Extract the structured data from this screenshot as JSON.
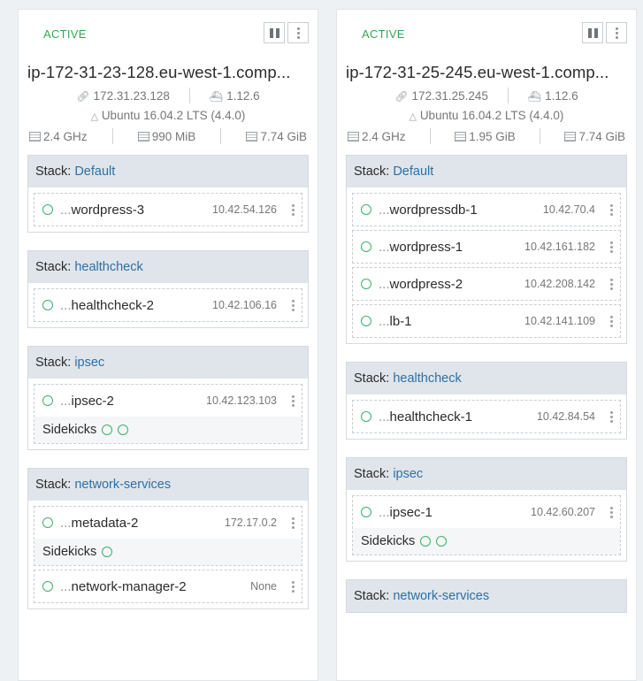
{
  "hosts": [
    {
      "state": "ACTIVE",
      "name": "ip-172-31-23-128.eu-west-1.comp...",
      "ip": "172.31.23.128",
      "docker_version": "1.12.6",
      "os": "Ubuntu 16.04.2 LTS (4.4.0)",
      "cpu": "2.4 GHz",
      "memory": "990 MiB",
      "storage": "7.74 GiB",
      "stacks": [
        {
          "label": "Stack:",
          "name": "Default",
          "containers": [
            {
              "name_prefix": "...",
              "name": "wordpress-3",
              "ip": "10.42.54.126"
            }
          ]
        },
        {
          "label": "Stack:",
          "name": "healthcheck",
          "containers": [
            {
              "name_prefix": "...",
              "name": "healthcheck-2",
              "ip": "10.42.106.16"
            }
          ]
        },
        {
          "label": "Stack:",
          "name": "ipsec",
          "containers": [
            {
              "name_prefix": "...",
              "name": "ipsec-2",
              "ip": "10.42.123.103",
              "sidekicks_label": "Sidekicks"
            }
          ]
        },
        {
          "label": "Stack:",
          "name": "network-services",
          "containers": [
            {
              "name_prefix": "...",
              "name": "metadata-2",
              "ip": "172.17.0.2",
              "sidekicks_label": "Sidekicks"
            },
            {
              "name_prefix": "...",
              "name": "network-manager-2",
              "ip": "None"
            }
          ]
        }
      ]
    },
    {
      "state": "ACTIVE",
      "name": "ip-172-31-25-245.eu-west-1.comp...",
      "ip": "172.31.25.245",
      "docker_version": "1.12.6",
      "os": "Ubuntu 16.04.2 LTS (4.4.0)",
      "cpu": "2.4 GHz",
      "memory": "1.95 GiB",
      "storage": "7.74 GiB",
      "stacks": [
        {
          "label": "Stack:",
          "name": "Default",
          "containers": [
            {
              "name_prefix": "...",
              "name": "wordpressdb-1",
              "ip": "10.42.70.4"
            },
            {
              "name_prefix": "...",
              "name": "wordpress-1",
              "ip": "10.42.161.182"
            },
            {
              "name_prefix": "...",
              "name": "wordpress-2",
              "ip": "10.42.208.142"
            },
            {
              "name_prefix": "...",
              "name": "lb-1",
              "ip": "10.42.141.109"
            }
          ]
        },
        {
          "label": "Stack:",
          "name": "healthcheck",
          "containers": [
            {
              "name_prefix": "...",
              "name": "healthcheck-1",
              "ip": "10.42.84.54"
            }
          ]
        },
        {
          "label": "Stack:",
          "name": "ipsec",
          "containers": [
            {
              "name_prefix": "...",
              "name": "ipsec-1",
              "ip": "10.42.60.207",
              "sidekicks_label": "Sidekicks"
            }
          ]
        },
        {
          "label": "Stack:",
          "name": "network-services",
          "containers": []
        }
      ]
    }
  ],
  "colors": {
    "active": "#33a852",
    "link": "#2f6fa3",
    "stack_header_bg": "#dfe5ea",
    "healthy": "#3bb16b"
  },
  "icons": [
    "pause-icon",
    "more-vertical-icon",
    "link-icon",
    "docker-icon",
    "ubuntu-icon",
    "cpu-icon",
    "memory-icon",
    "storage-icon",
    "status-circle-icon"
  ]
}
